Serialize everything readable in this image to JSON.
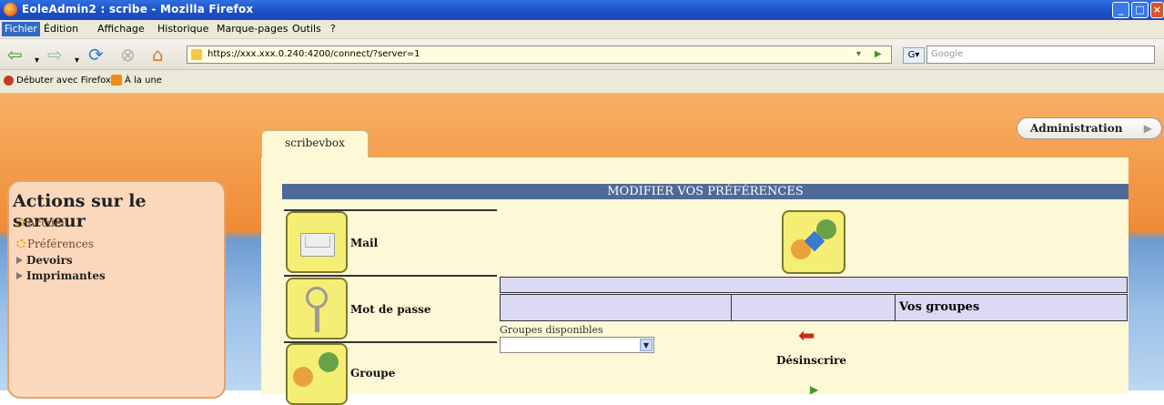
{
  "window": {
    "title": "EoleAdmin2 : scribe - Mozilla Firefox",
    "minimize": "_",
    "maximize": "□",
    "close": "×"
  },
  "menubar": {
    "items": [
      "Fichier",
      "Édition",
      "Affichage",
      "Historique",
      "Marque-pages",
      "Outils",
      "?"
    ]
  },
  "toolbar": {
    "url": "https://xxx.xxx.0.240:4200/connect/?server=1",
    "search_placeholder": "Google"
  },
  "bookmarks": {
    "items": [
      "Débuter avec Firefox",
      "À la une"
    ]
  },
  "page": {
    "admin_button": "Administration",
    "tab_label": "scribevbox",
    "left_panel": {
      "title": "Actions sur le serveur",
      "items": [
        {
          "label": "Accueil"
        },
        {
          "label": "Préférences"
        },
        {
          "label": "Devoirs"
        },
        {
          "label": "Imprimantes"
        }
      ]
    },
    "banner": "MODIFIER VOS PRÉFÉRENCES",
    "menu": [
      {
        "label": "Mail",
        "icon": "envelope-icon"
      },
      {
        "label": "Mot de passe",
        "icon": "keys-icon"
      },
      {
        "label": "Groupe",
        "icon": "group-icon"
      }
    ],
    "table": {
      "col_vos_groupes": "Vos groupes"
    },
    "groupes_disponibles": "Groupes disponibles",
    "desinscrire": "Désinscrire"
  }
}
